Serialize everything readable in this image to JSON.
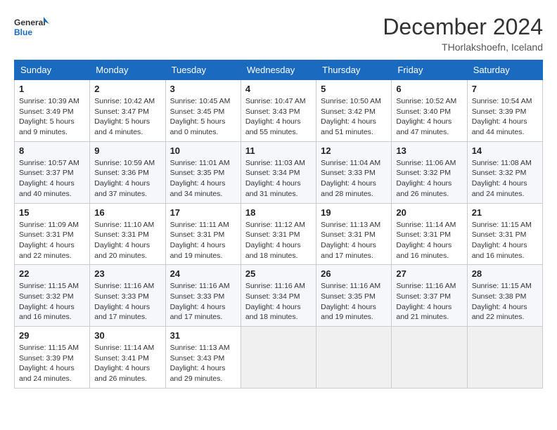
{
  "header": {
    "logo_line1": "General",
    "logo_line2": "Blue",
    "month": "December 2024",
    "location": "THorlakshoefn, Iceland"
  },
  "days_of_week": [
    "Sunday",
    "Monday",
    "Tuesday",
    "Wednesday",
    "Thursday",
    "Friday",
    "Saturday"
  ],
  "weeks": [
    [
      {
        "day": "1",
        "text": "Sunrise: 10:39 AM\nSunset: 3:49 PM\nDaylight: 5 hours\nand 9 minutes."
      },
      {
        "day": "2",
        "text": "Sunrise: 10:42 AM\nSunset: 3:47 PM\nDaylight: 5 hours\nand 4 minutes."
      },
      {
        "day": "3",
        "text": "Sunrise: 10:45 AM\nSunset: 3:45 PM\nDaylight: 5 hours\nand 0 minutes."
      },
      {
        "day": "4",
        "text": "Sunrise: 10:47 AM\nSunset: 3:43 PM\nDaylight: 4 hours\nand 55 minutes."
      },
      {
        "day": "5",
        "text": "Sunrise: 10:50 AM\nSunset: 3:42 PM\nDaylight: 4 hours\nand 51 minutes."
      },
      {
        "day": "6",
        "text": "Sunrise: 10:52 AM\nSunset: 3:40 PM\nDaylight: 4 hours\nand 47 minutes."
      },
      {
        "day": "7",
        "text": "Sunrise: 10:54 AM\nSunset: 3:39 PM\nDaylight: 4 hours\nand 44 minutes."
      }
    ],
    [
      {
        "day": "8",
        "text": "Sunrise: 10:57 AM\nSunset: 3:37 PM\nDaylight: 4 hours\nand 40 minutes."
      },
      {
        "day": "9",
        "text": "Sunrise: 10:59 AM\nSunset: 3:36 PM\nDaylight: 4 hours\nand 37 minutes."
      },
      {
        "day": "10",
        "text": "Sunrise: 11:01 AM\nSunset: 3:35 PM\nDaylight: 4 hours\nand 34 minutes."
      },
      {
        "day": "11",
        "text": "Sunrise: 11:03 AM\nSunset: 3:34 PM\nDaylight: 4 hours\nand 31 minutes."
      },
      {
        "day": "12",
        "text": "Sunrise: 11:04 AM\nSunset: 3:33 PM\nDaylight: 4 hours\nand 28 minutes."
      },
      {
        "day": "13",
        "text": "Sunrise: 11:06 AM\nSunset: 3:32 PM\nDaylight: 4 hours\nand 26 minutes."
      },
      {
        "day": "14",
        "text": "Sunrise: 11:08 AM\nSunset: 3:32 PM\nDaylight: 4 hours\nand 24 minutes."
      }
    ],
    [
      {
        "day": "15",
        "text": "Sunrise: 11:09 AM\nSunset: 3:31 PM\nDaylight: 4 hours\nand 22 minutes."
      },
      {
        "day": "16",
        "text": "Sunrise: 11:10 AM\nSunset: 3:31 PM\nDaylight: 4 hours\nand 20 minutes."
      },
      {
        "day": "17",
        "text": "Sunrise: 11:11 AM\nSunset: 3:31 PM\nDaylight: 4 hours\nand 19 minutes."
      },
      {
        "day": "18",
        "text": "Sunrise: 11:12 AM\nSunset: 3:31 PM\nDaylight: 4 hours\nand 18 minutes."
      },
      {
        "day": "19",
        "text": "Sunrise: 11:13 AM\nSunset: 3:31 PM\nDaylight: 4 hours\nand 17 minutes."
      },
      {
        "day": "20",
        "text": "Sunrise: 11:14 AM\nSunset: 3:31 PM\nDaylight: 4 hours\nand 16 minutes."
      },
      {
        "day": "21",
        "text": "Sunrise: 11:15 AM\nSunset: 3:31 PM\nDaylight: 4 hours\nand 16 minutes."
      }
    ],
    [
      {
        "day": "22",
        "text": "Sunrise: 11:15 AM\nSunset: 3:32 PM\nDaylight: 4 hours\nand 16 minutes."
      },
      {
        "day": "23",
        "text": "Sunrise: 11:16 AM\nSunset: 3:33 PM\nDaylight: 4 hours\nand 17 minutes."
      },
      {
        "day": "24",
        "text": "Sunrise: 11:16 AM\nSunset: 3:33 PM\nDaylight: 4 hours\nand 17 minutes."
      },
      {
        "day": "25",
        "text": "Sunrise: 11:16 AM\nSunset: 3:34 PM\nDaylight: 4 hours\nand 18 minutes."
      },
      {
        "day": "26",
        "text": "Sunrise: 11:16 AM\nSunset: 3:35 PM\nDaylight: 4 hours\nand 19 minutes."
      },
      {
        "day": "27",
        "text": "Sunrise: 11:16 AM\nSunset: 3:37 PM\nDaylight: 4 hours\nand 21 minutes."
      },
      {
        "day": "28",
        "text": "Sunrise: 11:15 AM\nSunset: 3:38 PM\nDaylight: 4 hours\nand 22 minutes."
      }
    ],
    [
      {
        "day": "29",
        "text": "Sunrise: 11:15 AM\nSunset: 3:39 PM\nDaylight: 4 hours\nand 24 minutes."
      },
      {
        "day": "30",
        "text": "Sunrise: 11:14 AM\nSunset: 3:41 PM\nDaylight: 4 hours\nand 26 minutes."
      },
      {
        "day": "31",
        "text": "Sunrise: 11:13 AM\nSunset: 3:43 PM\nDaylight: 4 hours\nand 29 minutes."
      },
      {
        "day": "",
        "text": ""
      },
      {
        "day": "",
        "text": ""
      },
      {
        "day": "",
        "text": ""
      },
      {
        "day": "",
        "text": ""
      }
    ]
  ]
}
